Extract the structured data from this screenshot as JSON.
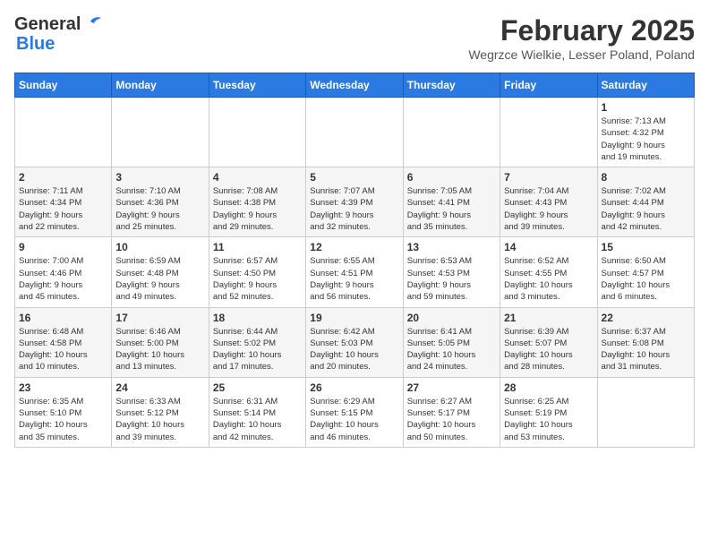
{
  "header": {
    "logo_general": "General",
    "logo_blue": "Blue",
    "month_title": "February 2025",
    "location": "Wegrzce Wielkie, Lesser Poland, Poland"
  },
  "days_of_week": [
    "Sunday",
    "Monday",
    "Tuesday",
    "Wednesday",
    "Thursday",
    "Friday",
    "Saturday"
  ],
  "weeks": [
    [
      {
        "day": "",
        "info": ""
      },
      {
        "day": "",
        "info": ""
      },
      {
        "day": "",
        "info": ""
      },
      {
        "day": "",
        "info": ""
      },
      {
        "day": "",
        "info": ""
      },
      {
        "day": "",
        "info": ""
      },
      {
        "day": "1",
        "info": "Sunrise: 7:13 AM\nSunset: 4:32 PM\nDaylight: 9 hours\nand 19 minutes."
      }
    ],
    [
      {
        "day": "2",
        "info": "Sunrise: 7:11 AM\nSunset: 4:34 PM\nDaylight: 9 hours\nand 22 minutes."
      },
      {
        "day": "3",
        "info": "Sunrise: 7:10 AM\nSunset: 4:36 PM\nDaylight: 9 hours\nand 25 minutes."
      },
      {
        "day": "4",
        "info": "Sunrise: 7:08 AM\nSunset: 4:38 PM\nDaylight: 9 hours\nand 29 minutes."
      },
      {
        "day": "5",
        "info": "Sunrise: 7:07 AM\nSunset: 4:39 PM\nDaylight: 9 hours\nand 32 minutes."
      },
      {
        "day": "6",
        "info": "Sunrise: 7:05 AM\nSunset: 4:41 PM\nDaylight: 9 hours\nand 35 minutes."
      },
      {
        "day": "7",
        "info": "Sunrise: 7:04 AM\nSunset: 4:43 PM\nDaylight: 9 hours\nand 39 minutes."
      },
      {
        "day": "8",
        "info": "Sunrise: 7:02 AM\nSunset: 4:44 PM\nDaylight: 9 hours\nand 42 minutes."
      }
    ],
    [
      {
        "day": "9",
        "info": "Sunrise: 7:00 AM\nSunset: 4:46 PM\nDaylight: 9 hours\nand 45 minutes."
      },
      {
        "day": "10",
        "info": "Sunrise: 6:59 AM\nSunset: 4:48 PM\nDaylight: 9 hours\nand 49 minutes."
      },
      {
        "day": "11",
        "info": "Sunrise: 6:57 AM\nSunset: 4:50 PM\nDaylight: 9 hours\nand 52 minutes."
      },
      {
        "day": "12",
        "info": "Sunrise: 6:55 AM\nSunset: 4:51 PM\nDaylight: 9 hours\nand 56 minutes."
      },
      {
        "day": "13",
        "info": "Sunrise: 6:53 AM\nSunset: 4:53 PM\nDaylight: 9 hours\nand 59 minutes."
      },
      {
        "day": "14",
        "info": "Sunrise: 6:52 AM\nSunset: 4:55 PM\nDaylight: 10 hours\nand 3 minutes."
      },
      {
        "day": "15",
        "info": "Sunrise: 6:50 AM\nSunset: 4:57 PM\nDaylight: 10 hours\nand 6 minutes."
      }
    ],
    [
      {
        "day": "16",
        "info": "Sunrise: 6:48 AM\nSunset: 4:58 PM\nDaylight: 10 hours\nand 10 minutes."
      },
      {
        "day": "17",
        "info": "Sunrise: 6:46 AM\nSunset: 5:00 PM\nDaylight: 10 hours\nand 13 minutes."
      },
      {
        "day": "18",
        "info": "Sunrise: 6:44 AM\nSunset: 5:02 PM\nDaylight: 10 hours\nand 17 minutes."
      },
      {
        "day": "19",
        "info": "Sunrise: 6:42 AM\nSunset: 5:03 PM\nDaylight: 10 hours\nand 20 minutes."
      },
      {
        "day": "20",
        "info": "Sunrise: 6:41 AM\nSunset: 5:05 PM\nDaylight: 10 hours\nand 24 minutes."
      },
      {
        "day": "21",
        "info": "Sunrise: 6:39 AM\nSunset: 5:07 PM\nDaylight: 10 hours\nand 28 minutes."
      },
      {
        "day": "22",
        "info": "Sunrise: 6:37 AM\nSunset: 5:08 PM\nDaylight: 10 hours\nand 31 minutes."
      }
    ],
    [
      {
        "day": "23",
        "info": "Sunrise: 6:35 AM\nSunset: 5:10 PM\nDaylight: 10 hours\nand 35 minutes."
      },
      {
        "day": "24",
        "info": "Sunrise: 6:33 AM\nSunset: 5:12 PM\nDaylight: 10 hours\nand 39 minutes."
      },
      {
        "day": "25",
        "info": "Sunrise: 6:31 AM\nSunset: 5:14 PM\nDaylight: 10 hours\nand 42 minutes."
      },
      {
        "day": "26",
        "info": "Sunrise: 6:29 AM\nSunset: 5:15 PM\nDaylight: 10 hours\nand 46 minutes."
      },
      {
        "day": "27",
        "info": "Sunrise: 6:27 AM\nSunset: 5:17 PM\nDaylight: 10 hours\nand 50 minutes."
      },
      {
        "day": "28",
        "info": "Sunrise: 6:25 AM\nSunset: 5:19 PM\nDaylight: 10 hours\nand 53 minutes."
      },
      {
        "day": "",
        "info": ""
      }
    ]
  ]
}
